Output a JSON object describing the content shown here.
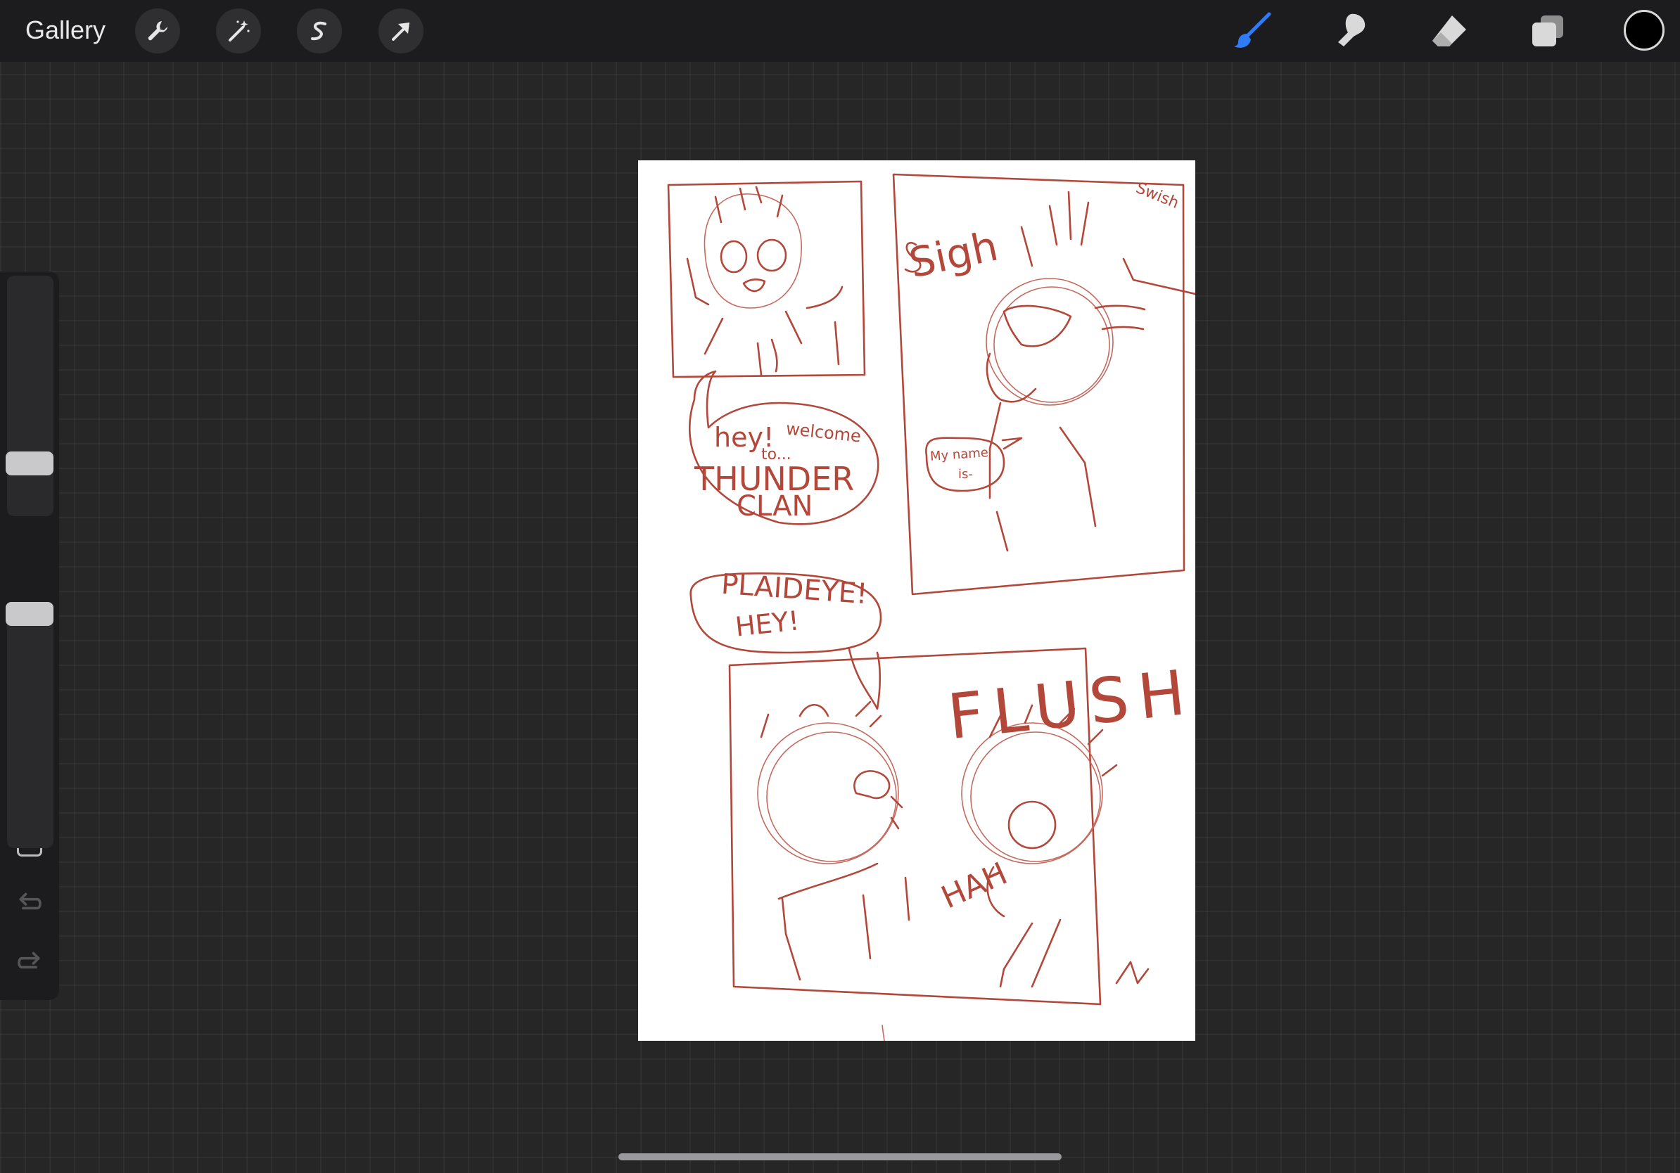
{
  "toolbar": {
    "gallery_label": "Gallery",
    "left_tools": [
      {
        "icon": "wrench-icon"
      },
      {
        "icon": "magic-wand-icon"
      },
      {
        "icon": "selection-s-icon"
      },
      {
        "icon": "arrow-transform-icon"
      }
    ],
    "right_tools": [
      {
        "icon": "brush-icon",
        "active": true,
        "color": "#2f7cf6"
      },
      {
        "icon": "smudge-icon",
        "active": false
      },
      {
        "icon": "eraser-icon",
        "active": false
      },
      {
        "icon": "layers-icon",
        "active": false
      }
    ],
    "current_color": "#000000"
  },
  "sidebar": {
    "brush_size_level": 0.73,
    "opacity_level": 0.95,
    "undo_icon": "undo-icon",
    "redo_icon": "redo-icon"
  },
  "canvas": {
    "ink_color": "#b2473a",
    "texts": {
      "swish": "Swish",
      "sigh": "Sigh",
      "hey_welcome_1": "hey!",
      "hey_welcome_2": "welcome",
      "hey_welcome_3": "to...",
      "thunder": "THUNDER",
      "clan": "CLAN",
      "my_name_1": "My name",
      "my_name_2": "is-",
      "plaideye": "PLAIDEYE!",
      "hey2": "HEY!",
      "flush": "FLUSH",
      "hah": "HAH",
      "signature": "W"
    }
  }
}
